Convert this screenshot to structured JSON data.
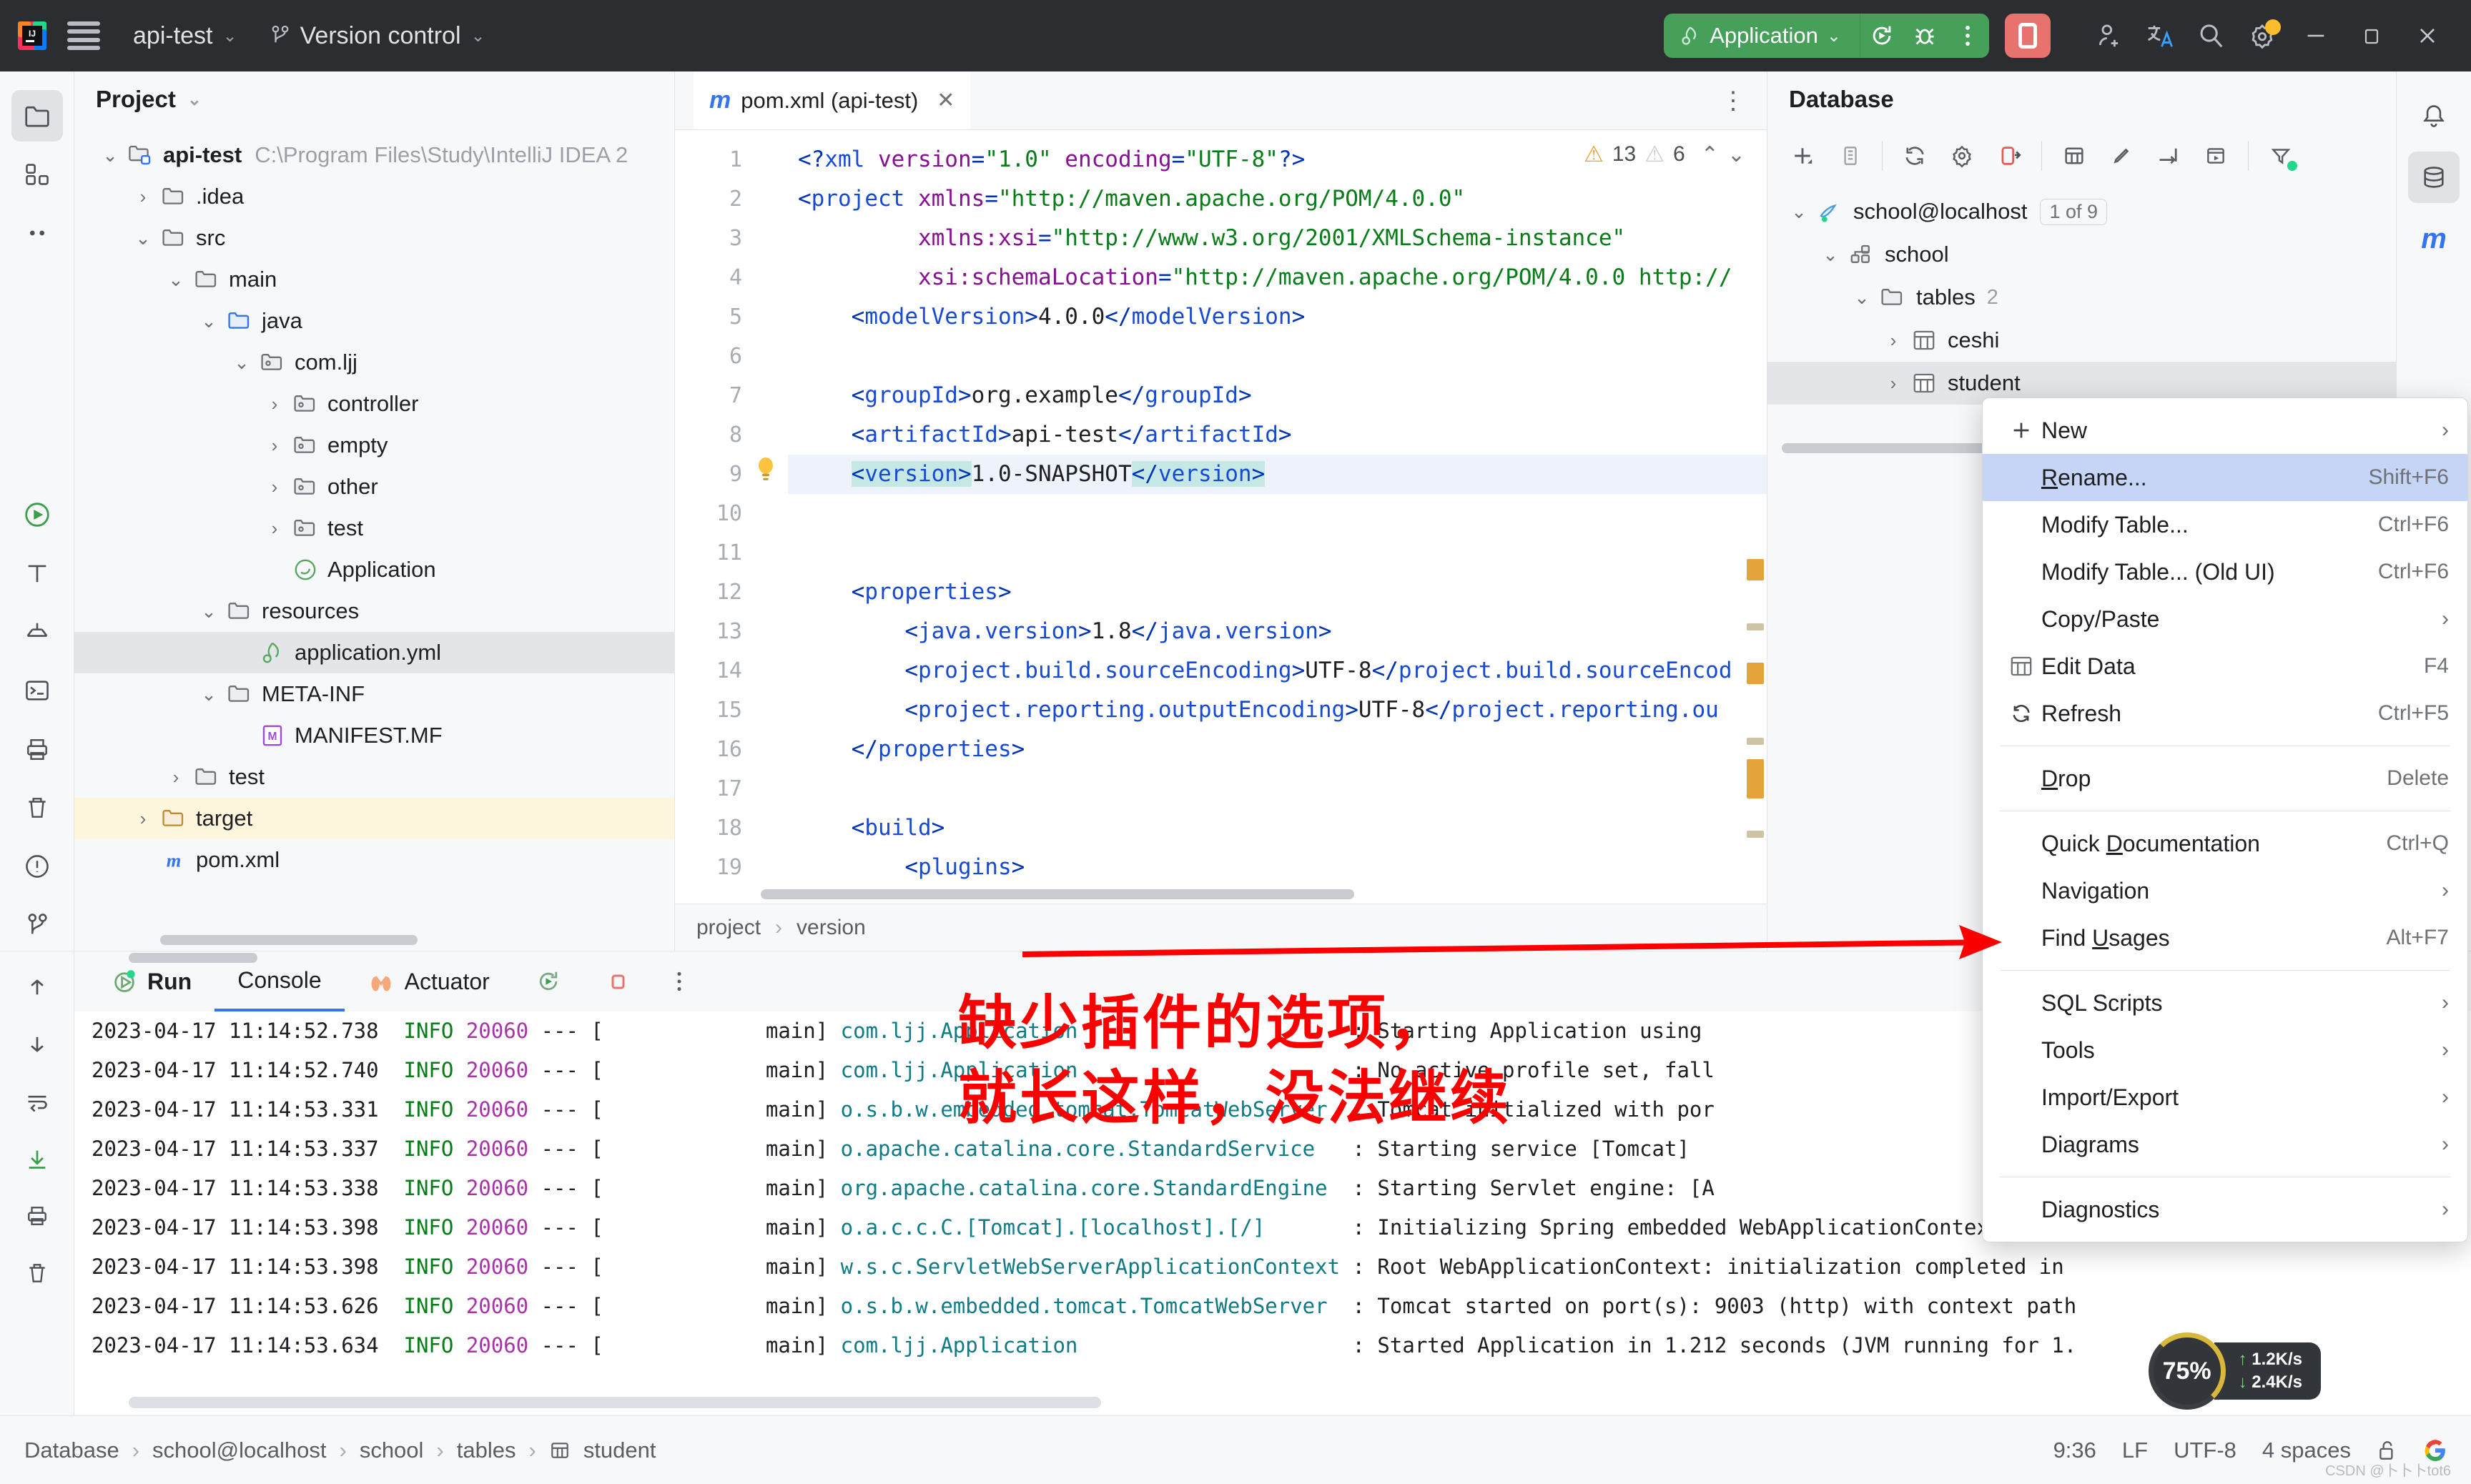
{
  "titlebar": {
    "project_name": "api-test",
    "vcs_label": "Version control",
    "run_config": "Application",
    "logo_alt": "intellij-idea-logo"
  },
  "project_panel": {
    "title": "Project",
    "tree": [
      {
        "label": "api-test",
        "path": "C:\\Program Files\\Study\\IntelliJ IDEA 2",
        "indent": 0,
        "arrow": "down",
        "icon": "module-folder-icon",
        "bold": true
      },
      {
        "label": ".idea",
        "path": "",
        "indent": 1,
        "arrow": "right",
        "icon": "folder-icon",
        "bold": false
      },
      {
        "label": "src",
        "path": "",
        "indent": 1,
        "arrow": "down",
        "icon": "folder-icon",
        "bold": false
      },
      {
        "label": "main",
        "path": "",
        "indent": 2,
        "arrow": "down",
        "icon": "folder-icon",
        "bold": false
      },
      {
        "label": "java",
        "path": "",
        "indent": 3,
        "arrow": "down",
        "icon": "source-folder-icon",
        "bold": false
      },
      {
        "label": "com.ljj",
        "path": "",
        "indent": 4,
        "arrow": "down",
        "icon": "package-icon",
        "bold": false
      },
      {
        "label": "controller",
        "path": "",
        "indent": 5,
        "arrow": "right",
        "icon": "package-icon",
        "bold": false
      },
      {
        "label": "empty",
        "path": "",
        "indent": 5,
        "arrow": "right",
        "icon": "package-icon",
        "bold": false
      },
      {
        "label": "other",
        "path": "",
        "indent": 5,
        "arrow": "right",
        "icon": "package-icon",
        "bold": false
      },
      {
        "label": "test",
        "path": "",
        "indent": 5,
        "arrow": "right",
        "icon": "package-icon",
        "bold": false
      },
      {
        "label": "Application",
        "path": "",
        "indent": 5,
        "arrow": "none",
        "icon": "spring-class-icon",
        "bold": false
      },
      {
        "label": "resources",
        "path": "",
        "indent": 3,
        "arrow": "down",
        "icon": "resources-folder-icon",
        "bold": false
      },
      {
        "label": "application.yml",
        "path": "",
        "indent": 4,
        "arrow": "none",
        "icon": "spring-yaml-icon",
        "bold": false,
        "selected": true
      },
      {
        "label": "META-INF",
        "path": "",
        "indent": 3,
        "arrow": "down",
        "icon": "folder-icon",
        "bold": false
      },
      {
        "label": "MANIFEST.MF",
        "path": "",
        "indent": 4,
        "arrow": "none",
        "icon": "manifest-icon",
        "bold": false
      },
      {
        "label": "test",
        "path": "",
        "indent": 2,
        "arrow": "right",
        "icon": "folder-icon",
        "bold": false
      },
      {
        "label": "target",
        "path": "",
        "indent": 1,
        "arrow": "right",
        "icon": "target-folder-icon",
        "bold": false,
        "highlight": true
      },
      {
        "label": "pom.xml",
        "path": "",
        "indent": 1,
        "arrow": "none",
        "icon": "maven-icon",
        "bold": false
      }
    ]
  },
  "editor": {
    "tab_label": "pom.xml (api-test)",
    "tab_icon": "maven-m-icon",
    "inspections": {
      "warnings": "13",
      "weak_warnings": "6"
    },
    "breadcrumbs": [
      "project",
      "version"
    ],
    "lines": [
      {
        "n": "1",
        "bulb": false,
        "hl": false,
        "html": "<span class=\"tg\">&lt;?</span><span class=\"at\">xml </span><span class=\"nm\">version</span><span class=\"tg\">=</span><span class=\"st\">\"1.0\"</span><span class=\"nm\"> encoding</span><span class=\"tg\">=</span><span class=\"st\">\"UTF-8\"</span><span class=\"tg\">?&gt;</span>"
      },
      {
        "n": "2",
        "bulb": false,
        "hl": false,
        "html": "<span class=\"tg\">&lt;</span><span class=\"at\">project </span><span class=\"nm\">xmlns</span><span class=\"tg\">=</span><span class=\"st\">\"http://maven.apache.org/POM/4.0.0\"</span>"
      },
      {
        "n": "3",
        "bulb": false,
        "hl": false,
        "html": "         <span class=\"nm\">xmlns:xsi</span><span class=\"tg\">=</span><span class=\"st\">\"http://www.w3.org/2001/XMLSchema-instance\"</span>"
      },
      {
        "n": "4",
        "bulb": false,
        "hl": false,
        "html": "         <span class=\"nm\">xsi:schemaLocation</span><span class=\"tg\">=</span><span class=\"st\">\"http://maven.apache.org/POM/4.0.0 http://</span>"
      },
      {
        "n": "5",
        "bulb": false,
        "hl": false,
        "html": "    <span class=\"tg\">&lt;</span><span class=\"at\">modelVersion</span><span class=\"tg\">&gt;</span><span class=\"tx\">4.0.0</span><span class=\"tg\">&lt;/</span><span class=\"at\">modelVersion</span><span class=\"tg\">&gt;</span>"
      },
      {
        "n": "6",
        "bulb": false,
        "hl": false,
        "html": ""
      },
      {
        "n": "7",
        "bulb": false,
        "hl": false,
        "html": "    <span class=\"tg\">&lt;</span><span class=\"at\">groupId</span><span class=\"tg\">&gt;</span><span class=\"tx\">org.example</span><span class=\"tg\">&lt;/</span><span class=\"at\">groupId</span><span class=\"tg\">&gt;</span>"
      },
      {
        "n": "8",
        "bulb": false,
        "hl": false,
        "html": "    <span class=\"tg\">&lt;</span><span class=\"at\">artifactId</span><span class=\"tg\">&gt;</span><span class=\"tx\">api-test</span><span class=\"tg\">&lt;/</span><span class=\"at\">artifactId</span><span class=\"tg\">&gt;</span>"
      },
      {
        "n": "9",
        "bulb": true,
        "hl": true,
        "html": "    <span class=\"sel-hl\"><span class=\"tg\">&lt;</span><span class=\"at\">version</span><span class=\"tg\">&gt;</span></span><span class=\"tx\">1.0-SNAPSHOT</span><span class=\"sel-hl\"><span class=\"tg\">&lt;/</span><span class=\"at\">version</span><span class=\"tg\">&gt;</span></span>"
      },
      {
        "n": "10",
        "bulb": false,
        "hl": false,
        "html": ""
      },
      {
        "n": "11",
        "bulb": false,
        "hl": false,
        "html": ""
      },
      {
        "n": "12",
        "bulb": false,
        "hl": false,
        "html": "    <span class=\"tg\">&lt;</span><span class=\"at\">properties</span><span class=\"tg\">&gt;</span>"
      },
      {
        "n": "13",
        "bulb": false,
        "hl": false,
        "html": "        <span class=\"tg\">&lt;</span><span class=\"at\">java.version</span><span class=\"tg\">&gt;</span><span class=\"tx\">1.8</span><span class=\"tg\">&lt;/</span><span class=\"at\">java.version</span><span class=\"tg\">&gt;</span>"
      },
      {
        "n": "14",
        "bulb": false,
        "hl": false,
        "html": "        <span class=\"tg\">&lt;</span><span class=\"at\">project.build.sourceEncoding</span><span class=\"tg\">&gt;</span><span class=\"tx\">UTF-8</span><span class=\"tg\">&lt;/</span><span class=\"at\">project.build.sourceEncod</span>"
      },
      {
        "n": "15",
        "bulb": false,
        "hl": false,
        "html": "        <span class=\"tg\">&lt;</span><span class=\"at\">project.reporting.outputEncoding</span><span class=\"tg\">&gt;</span><span class=\"tx\">UTF-8</span><span class=\"tg\">&lt;/</span><span class=\"at\">project.reporting.ou</span>"
      },
      {
        "n": "16",
        "bulb": false,
        "hl": false,
        "html": "    <span class=\"tg\">&lt;/</span><span class=\"at\">properties</span><span class=\"tg\">&gt;</span>"
      },
      {
        "n": "17",
        "bulb": false,
        "hl": false,
        "html": ""
      },
      {
        "n": "18",
        "bulb": false,
        "hl": false,
        "html": "    <span class=\"tg\">&lt;</span><span class=\"at\">build</span><span class=\"tg\">&gt;</span>"
      },
      {
        "n": "19",
        "bulb": false,
        "hl": false,
        "html": "        <span class=\"tg\">&lt;</span><span class=\"at\">plugins</span><span class=\"tg\">&gt;</span>"
      }
    ]
  },
  "database_panel": {
    "title": "Database",
    "toolbar_icons": [
      "add-icon",
      "duplicate-icon",
      "sync-icon",
      "settings-icon",
      "disconnect-icon",
      "table-icon",
      "edit-icon",
      "import-icon",
      "console-icon",
      "filter-icon"
    ],
    "tree": [
      {
        "label": "school@localhost",
        "badge": "1 of 9",
        "indent": 0,
        "arrow": "down",
        "icon": "mysql-icon"
      },
      {
        "label": "school",
        "badge": "",
        "indent": 1,
        "arrow": "down",
        "icon": "schema-icon"
      },
      {
        "label": "tables",
        "count": "2",
        "indent": 2,
        "arrow": "down",
        "icon": "folder-icon"
      },
      {
        "label": "ceshi",
        "badge": "",
        "indent": 3,
        "arrow": "right",
        "icon": "table-icon"
      },
      {
        "label": "student",
        "badge": "",
        "indent": 3,
        "arrow": "right",
        "icon": "table-icon",
        "selected": true
      }
    ]
  },
  "context_menu": {
    "items": [
      {
        "label": "New",
        "mnemonic": "",
        "accel": "",
        "icon": "plus-icon",
        "submenu": true,
        "selected": false
      },
      {
        "label": "Rename...",
        "mnemonic": "R",
        "accel": "Shift+F6",
        "icon": "",
        "submenu": false,
        "selected": true
      },
      {
        "label": "Modify Table...",
        "mnemonic": "",
        "accel": "Ctrl+F6",
        "icon": "",
        "submenu": false,
        "selected": false
      },
      {
        "label": "Modify Table... (Old UI)",
        "mnemonic": "",
        "accel": "Ctrl+F6",
        "icon": "",
        "submenu": false,
        "selected": false
      },
      {
        "label": "Copy/Paste",
        "mnemonic": "",
        "accel": "",
        "icon": "",
        "submenu": true,
        "selected": false
      },
      {
        "label": "Edit Data",
        "mnemonic": "",
        "accel": "F4",
        "icon": "table-icon",
        "submenu": false,
        "selected": false
      },
      {
        "label": "Refresh",
        "mnemonic": "",
        "accel": "Ctrl+F5",
        "icon": "refresh-icon",
        "submenu": false,
        "selected": false
      },
      {
        "separator": true
      },
      {
        "label": "Drop",
        "mnemonic": "D",
        "accel": "Delete",
        "icon": "",
        "submenu": false,
        "selected": false
      },
      {
        "separator": true
      },
      {
        "label": "Quick Documentation",
        "mnemonic": "D",
        "accel": "Ctrl+Q",
        "icon": "",
        "submenu": false,
        "selected": false
      },
      {
        "label": "Navigation",
        "mnemonic": "",
        "accel": "",
        "icon": "",
        "submenu": true,
        "selected": false
      },
      {
        "label": "Find Usages",
        "mnemonic": "U",
        "accel": "Alt+F7",
        "icon": "",
        "submenu": false,
        "selected": false
      },
      {
        "separator": true
      },
      {
        "label": "SQL Scripts",
        "mnemonic": "",
        "accel": "",
        "icon": "",
        "submenu": true,
        "selected": false
      },
      {
        "label": "Tools",
        "mnemonic": "",
        "accel": "",
        "icon": "",
        "submenu": true,
        "selected": false
      },
      {
        "label": "Import/Export",
        "mnemonic": "",
        "accel": "",
        "icon": "",
        "submenu": true,
        "selected": false
      },
      {
        "label": "Diagrams",
        "mnemonic": "",
        "accel": "",
        "icon": "",
        "submenu": true,
        "selected": false
      },
      {
        "separator": true
      },
      {
        "label": "Diagnostics",
        "mnemonic": "",
        "accel": "",
        "icon": "",
        "submenu": true,
        "selected": false
      }
    ]
  },
  "run_panel": {
    "tabs": [
      {
        "label": "Run",
        "icon": "run-icon",
        "active": true
      },
      {
        "label": "Console",
        "icon": "",
        "active": false
      },
      {
        "label": "Actuator",
        "icon": "actuator-icon",
        "active": false
      }
    ],
    "console_lines": [
      {
        "date": "2023-04-17 11:14:52.738",
        "level": "INFO",
        "pid": "20060",
        "thread": "main]",
        "cls": "com.ljj.Application",
        "msg": ": Starting Application using"
      },
      {
        "date": "2023-04-17 11:14:52.740",
        "level": "INFO",
        "pid": "20060",
        "thread": "main]",
        "cls": "com.ljj.Application",
        "msg": ": No active profile set, fall"
      },
      {
        "date": "2023-04-17 11:14:53.331",
        "level": "INFO",
        "pid": "20060",
        "thread": "main]",
        "cls": "o.s.b.w.embedded.tomcat.TomcatWebServer",
        "msg": ": Tomcat initialized with por"
      },
      {
        "date": "2023-04-17 11:14:53.337",
        "level": "INFO",
        "pid": "20060",
        "thread": "main]",
        "cls": "o.apache.catalina.core.StandardService",
        "msg": ": Starting service [Tomcat]"
      },
      {
        "date": "2023-04-17 11:14:53.338",
        "level": "INFO",
        "pid": "20060",
        "thread": "main]",
        "cls": "org.apache.catalina.core.StandardEngine",
        "msg": ": Starting Servlet engine: [A"
      },
      {
        "date": "2023-04-17 11:14:53.398",
        "level": "INFO",
        "pid": "20060",
        "thread": "main]",
        "cls": "o.a.c.c.C.[Tomcat].[localhost].[/]",
        "msg": ": Initializing Spring embedded WebApplicationContext"
      },
      {
        "date": "2023-04-17 11:14:53.398",
        "level": "INFO",
        "pid": "20060",
        "thread": "main]",
        "cls": "w.s.c.ServletWebServerApplicationContext",
        "msg": ": Root WebApplicationContext: initialization completed in"
      },
      {
        "date": "2023-04-17 11:14:53.626",
        "level": "INFO",
        "pid": "20060",
        "thread": "main]",
        "cls": "o.s.b.w.embedded.tomcat.TomcatWebServer",
        "msg": ": Tomcat started on port(s): 9003 (http) with context path"
      },
      {
        "date": "2023-04-17 11:14:53.634",
        "level": "INFO",
        "pid": "20060",
        "thread": "main]",
        "cls": "com.ljj.Application",
        "msg": ": Started Application in 1.212 seconds (JVM running for 1."
      }
    ]
  },
  "annotation": {
    "line1": "缺少插件的选项，",
    "line2": "就长这样，没法继续"
  },
  "statusbar": {
    "breadcrumbs": [
      "Database",
      "school@localhost",
      "school",
      "tables",
      "student"
    ],
    "table_icon": "table-icon",
    "position": "9:36",
    "line_sep": "LF",
    "encoding": "UTF-8",
    "indent": "4 spaces",
    "lock_icon": "unlocked-icon",
    "google_icon": "google-icon",
    "watermark": "CSDN @卜卜卜tot6"
  },
  "fps_widget": {
    "percent": "75%",
    "up_rate": "1.2K/s",
    "down_rate": "2.4K/s"
  },
  "colors": {
    "accent_blue": "#3574f0",
    "run_green": "#47a05a",
    "stop_red": "#e8736e",
    "annotation_red": "#fb0000",
    "menu_select": "#c6d4f5"
  }
}
